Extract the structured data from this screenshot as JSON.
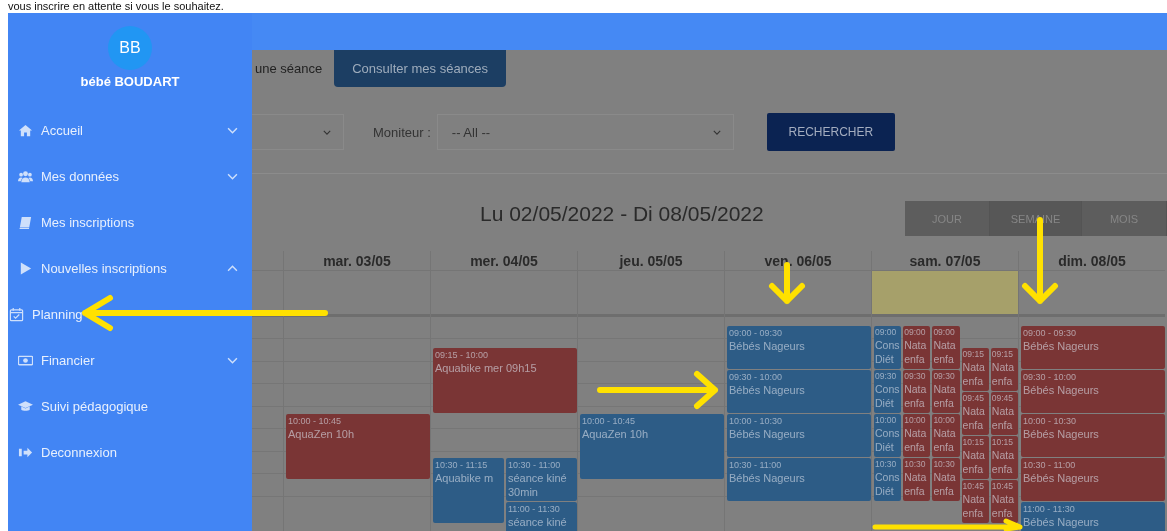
{
  "caption": "vous inscrire en attente si vous le souhaitez.",
  "user": {
    "initials": "BB",
    "name": "bébé BOUDART"
  },
  "sidebar": {
    "items": [
      {
        "label": "Accueil",
        "expanded": false
      },
      {
        "label": "Mes données",
        "expanded": false
      },
      {
        "label": "Mes inscriptions"
      },
      {
        "label": "Nouvelles inscriptions",
        "expanded": true,
        "children": [
          {
            "label": "Planning"
          }
        ]
      },
      {
        "label": "Financier",
        "expanded": false
      },
      {
        "label": "Suivi pédagogique"
      },
      {
        "label": "Deconnexion"
      }
    ]
  },
  "tabs": [
    {
      "label": "une séance",
      "selected": false
    },
    {
      "label": "Consulter mes séances",
      "selected": true
    }
  ],
  "filters": {
    "moniteur_label": "Moniteur :",
    "moniteur_value": "-- All --",
    "search_button": "RECHERCHER"
  },
  "calendar": {
    "title": "Lu 02/05/2022 - Di 08/05/2022",
    "views": [
      {
        "label": "JOUR",
        "selected": false
      },
      {
        "label": "SEMAINE",
        "selected": true
      },
      {
        "label": "MOIS",
        "selected": false
      }
    ],
    "days": [
      {
        "label": "mar. 03/05",
        "today": false,
        "events": [
          {
            "time": "10:00 - 10:45",
            "title": "AquaZen 10h",
            "color": "#7a3535"
          }
        ]
      },
      {
        "label": "mer. 04/05",
        "today": false,
        "events": [
          {
            "time": "09:15 - 10:00",
            "title": "Aquabike mer 09h15",
            "color": "#7a3535"
          },
          {
            "time": "10:30 - 11:15",
            "title": "Aquabike m",
            "color": "#2d5c86"
          },
          {
            "time": "10:30 - 11:00",
            "title": "séance kiné",
            "subtitle": "30min",
            "color": "#2d5c86"
          },
          {
            "time": "11:00 - 11:30",
            "title": "séance kiné",
            "color": "#2d5c86"
          }
        ]
      },
      {
        "label": "jeu. 05/05",
        "today": false,
        "events": [
          {
            "time": "10:00 - 10:45",
            "title": "AquaZen 10h",
            "color": "#2d5c86"
          }
        ]
      },
      {
        "label": "ven. 06/05",
        "today": false,
        "events": [
          {
            "time": "09:00 - 09:30",
            "title": "Bébés Nageurs",
            "color": "#2d5c86"
          },
          {
            "time": "09:30 - 10:00",
            "title": "Bébés Nageurs",
            "color": "#2d5c86"
          },
          {
            "time": "10:00 - 10:30",
            "title": "Bébés Nageurs",
            "color": "#2d5c86"
          },
          {
            "time": "10:30 - 11:00",
            "title": "Bébés Nageurs",
            "color": "#2d5c86"
          }
        ]
      },
      {
        "label": "sam. 07/05",
        "today": true,
        "events": [
          {
            "time": "09:00",
            "title": "Cons",
            "subtitle": "Diét",
            "color": "#2d5c86"
          },
          {
            "time": "09:00",
            "title": "Nata",
            "subtitle": "enfa",
            "color": "#7a3535"
          },
          {
            "time": "09:00",
            "title": "Nata",
            "subtitle": "enfa",
            "color": "#7a3535"
          },
          {
            "time": "09:15",
            "title": "Nata",
            "subtitle": "enfa",
            "color": "#7a3535"
          },
          {
            "time": "09:15",
            "title": "Nata",
            "subtitle": "enfa",
            "color": "#7a3535"
          },
          {
            "time": "09:30",
            "title": "Cons",
            "subtitle": "Diét",
            "color": "#2d5c86"
          },
          {
            "time": "09:30",
            "title": "Nata",
            "subtitle": "enfa",
            "color": "#7a3535"
          },
          {
            "time": "09:30",
            "title": "Nata",
            "subtitle": "enfa",
            "color": "#7a3535"
          },
          {
            "time": "09:45",
            "title": "Nata",
            "subtitle": "enfa",
            "color": "#7a3535"
          },
          {
            "time": "09:45",
            "title": "Nata",
            "subtitle": "enfa",
            "color": "#7a3535"
          },
          {
            "time": "10:00",
            "title": "Cons",
            "subtitle": "Diét",
            "color": "#2d5c86"
          },
          {
            "time": "10:00",
            "title": "Nata",
            "subtitle": "enfa",
            "color": "#7a3535"
          },
          {
            "time": "10:00",
            "title": "Nata",
            "subtitle": "enfa",
            "color": "#7a3535"
          },
          {
            "time": "10:15",
            "title": "Nata",
            "subtitle": "enfa",
            "color": "#7a3535"
          },
          {
            "time": "10:15",
            "title": "Nata",
            "subtitle": "enfa",
            "color": "#7a3535"
          },
          {
            "time": "10:30",
            "title": "Cons",
            "subtitle": "Diét",
            "color": "#2d5c86"
          },
          {
            "time": "10:30",
            "title": "Nata",
            "subtitle": "enfa",
            "color": "#7a3535"
          },
          {
            "time": "10:30",
            "title": "Nata",
            "subtitle": "enfa",
            "color": "#7a3535"
          },
          {
            "time": "10:45",
            "title": "Nata",
            "subtitle": "enfa",
            "color": "#7a3535"
          },
          {
            "time": "10:45",
            "title": "Nata",
            "subtitle": "enfa",
            "color": "#7a3535"
          }
        ]
      },
      {
        "label": "dim. 08/05",
        "today": false,
        "events": [
          {
            "time": "09:00 - 09:30",
            "title": "Bébés Nageurs",
            "color": "#7a3535"
          },
          {
            "time": "09:30 - 10:00",
            "title": "Bébés Nageurs",
            "color": "#7a3535"
          },
          {
            "time": "10:00 - 10:30",
            "title": "Bébés Nageurs",
            "color": "#7a3535"
          },
          {
            "time": "10:30 - 11:00",
            "title": "Bébés Nageurs",
            "color": "#7a3535"
          },
          {
            "time": "11:00 - 11:30",
            "title": "Bébés Nageurs",
            "color": "#2d5c86"
          }
        ]
      }
    ]
  }
}
